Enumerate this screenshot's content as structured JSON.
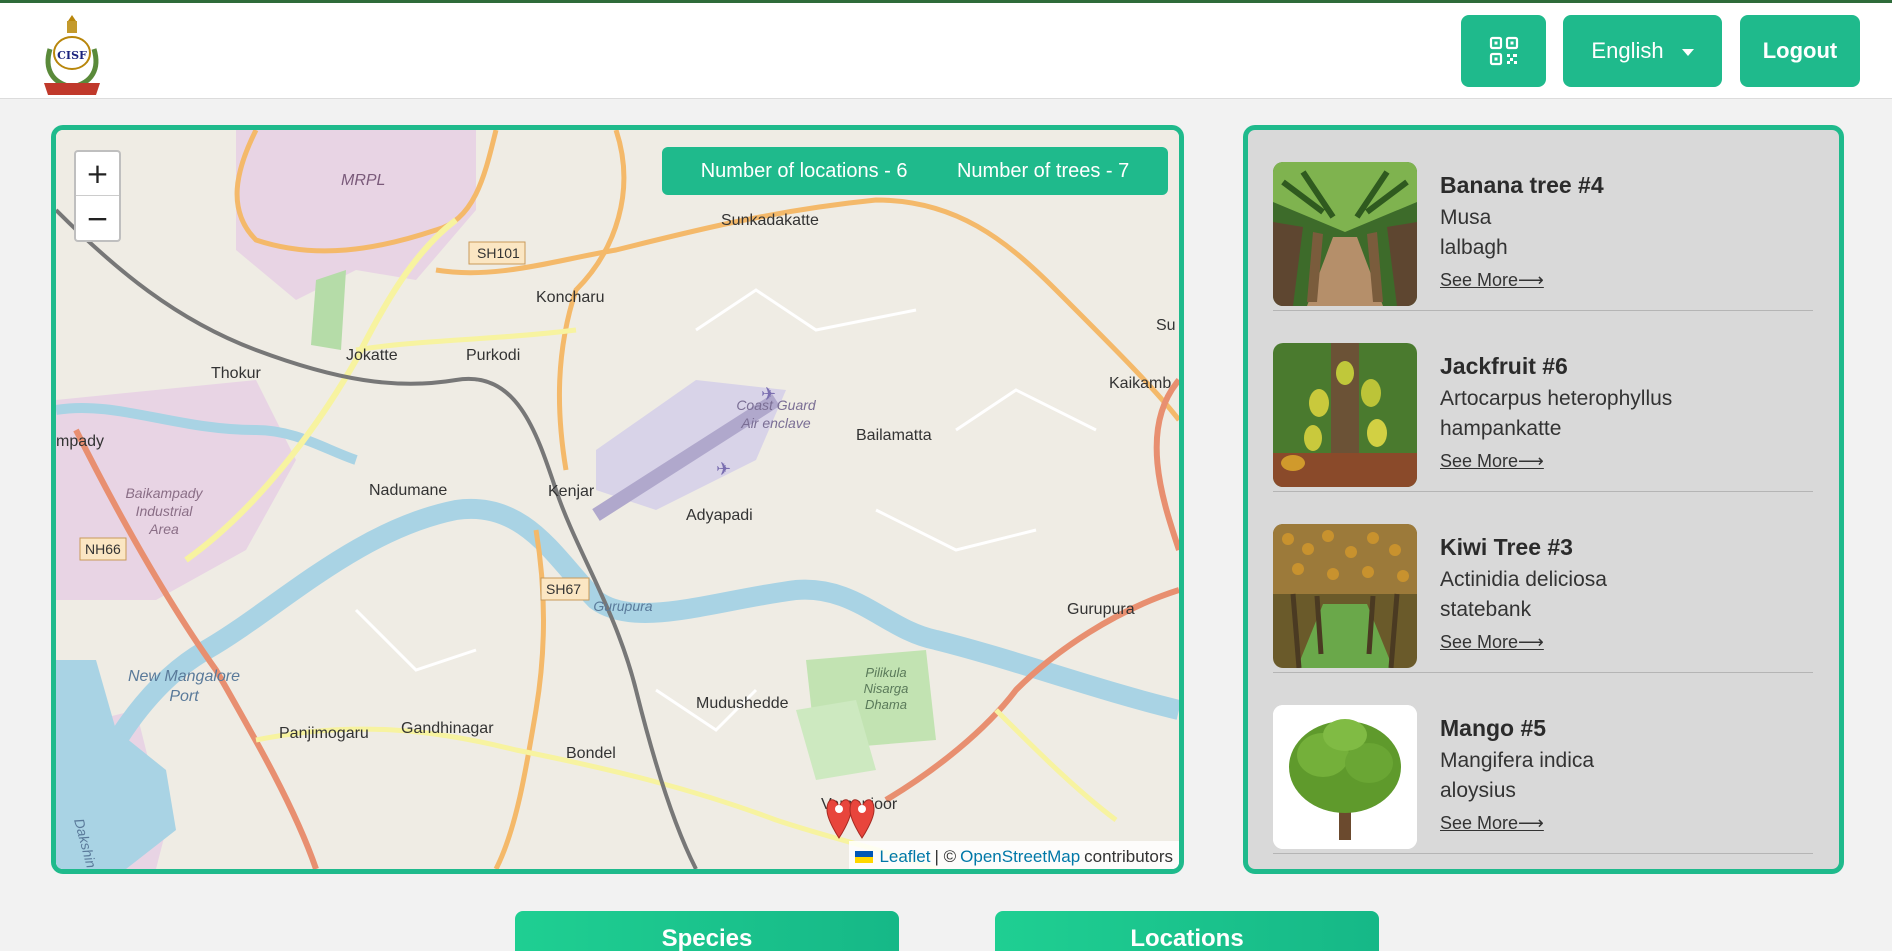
{
  "header": {
    "logo_text": "CISF",
    "qr_icon": "qr-code-icon",
    "language": "English",
    "logout_label": "Logout"
  },
  "map": {
    "zoom_in": "+",
    "zoom_out": "−",
    "stats": {
      "locations": "Number of locations - 6",
      "trees": "Number of trees - 7"
    },
    "attribution": {
      "leaflet": "Leaflet",
      "separator": "| ©",
      "osm": "OpenStreetMap",
      "contributors": "contributors"
    },
    "labels": {
      "mrpl": "MRPL",
      "sh101": "SH101",
      "sunkadakatte": "Sunkadakatte",
      "koncharu": "Koncharu",
      "jokatte": "Jokatte",
      "purkodi": "Purkodi",
      "thokur": "Thokur",
      "kaikamba": "Kaikamb",
      "su": "Su",
      "coast_guard_1": "Coast Guard",
      "coast_guard_2": "Air enclave",
      "bailamatta": "Bailamatta",
      "mpady": "mpady",
      "baikampady_1": "Baikampady",
      "baikampady_2": "Industrial",
      "baikampady_3": "Area",
      "nadumane": "Nadumane",
      "kenjar": "Kenjar",
      "adyapadi": "Adyapadi",
      "nh66": "NH66",
      "sh67": "SH67",
      "gurupura_river": "Gurupura",
      "gurupura": "Gurupura",
      "new_mangalore_1": "New Mangalore",
      "new_mangalore_2": "Port",
      "mudushedde": "Mudushedde",
      "pilikula_1": "Pilikula",
      "pilikula_2": "Nisarga",
      "pilikula_3": "Dhama",
      "panjimogaru": "Panjimogaru",
      "gandhinagar": "Gandhinagar",
      "bondel": "Bondel",
      "vamanjoor": "Vamanjoor",
      "dakshin": "Dakshin"
    }
  },
  "trees": [
    {
      "title": "Banana tree #4",
      "scientific": "Musa",
      "location": "lalbagh",
      "more": "See More⟶"
    },
    {
      "title": "Jackfruit #6",
      "scientific": "Artocarpus heterophyllus",
      "location": "hampankatte",
      "more": "See More⟶"
    },
    {
      "title": "Kiwi Tree #3",
      "scientific": "Actinidia deliciosa",
      "location": "statebank",
      "more": "See More⟶"
    },
    {
      "title": "Mango #5",
      "scientific": "Mangifera indica",
      "location": "aloysius",
      "more": "See More⟶"
    }
  ],
  "tabs": {
    "species": "Species",
    "locations": "Locations"
  }
}
